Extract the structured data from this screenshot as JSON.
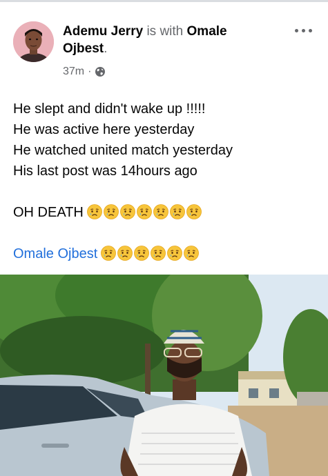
{
  "post": {
    "author": "Ademu Jerry",
    "with_text": "is with",
    "tagged_first": "Omale",
    "tagged_last": "Ojbest",
    "period": ".",
    "time": "37m",
    "dot": "·",
    "privacy_icon": "globe-icon",
    "more_icon": "more-options-icon",
    "lines": [
      "He slept and didn't wake up !!!!!",
      "He was active here yesterday",
      "He watched united match yesterday",
      "His last post was 14hours ago"
    ],
    "exclaim": "OH DEATH",
    "exclaim_emoji_count": 7,
    "tag_mention": "Omale Ojbest",
    "tag_emoji_count": 6,
    "emoji_name": "sad-face-with-tear-emoji"
  },
  "colors": {
    "name_text": "#050505",
    "secondary_text": "#65676b",
    "link_blue": "#216fdb"
  }
}
